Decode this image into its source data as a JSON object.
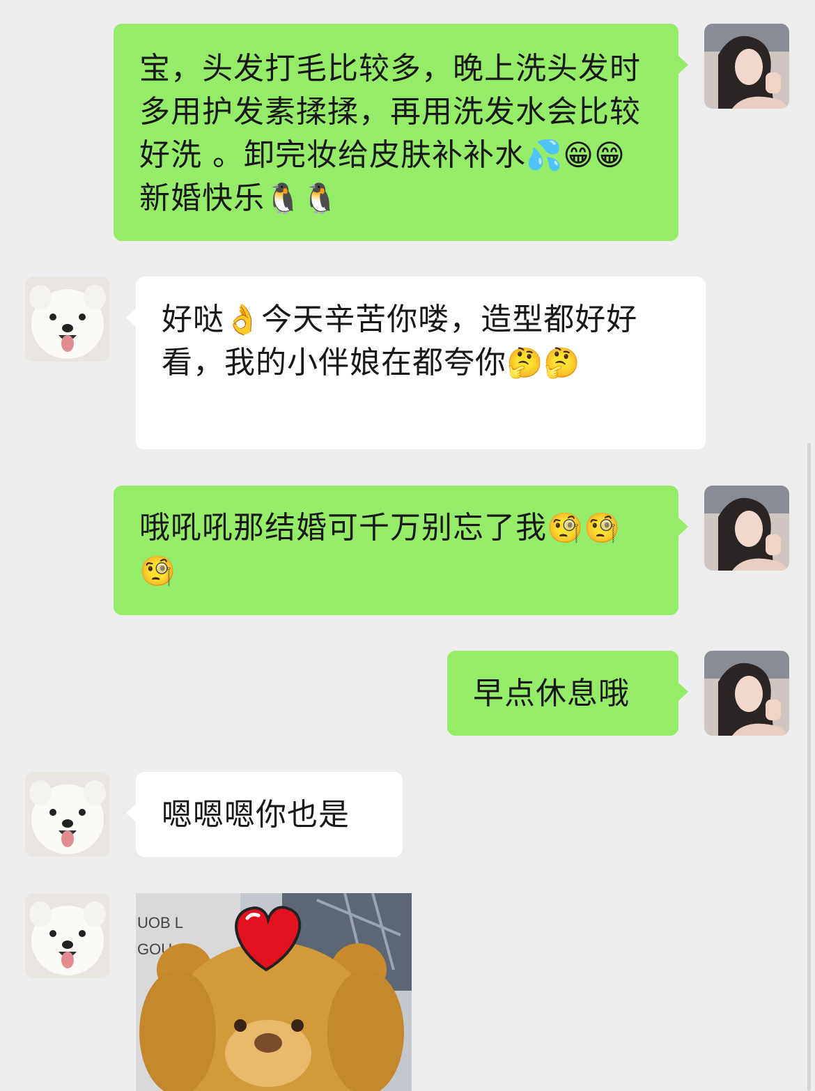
{
  "messages": [
    {
      "sender": "me",
      "parts": [
        {
          "t": "宝，头发打毛比较多，晚上洗头发时多用护发素揉揉，再用洗发水会比较好洗 。卸完妆给皮肤补补水"
        },
        {
          "e": "💦"
        },
        {
          "e": "😁"
        },
        {
          "e": "😁"
        },
        {
          "t": "新婚快乐"
        },
        {
          "e": "🐧"
        },
        {
          "e": "🐧"
        }
      ]
    },
    {
      "sender": "them",
      "parts": [
        {
          "t": "好哒"
        },
        {
          "e": "👌"
        },
        {
          "t": "今天辛苦你喽，造型都好好看，我的小伴娘在都夸你"
        },
        {
          "e": "🤔"
        },
        {
          "e": "🤔"
        }
      ]
    },
    {
      "sender": "me",
      "parts": [
        {
          "t": "哦吼吼那结婚可千万别忘了我"
        },
        {
          "e": "🧐"
        },
        {
          "e": "🧐"
        },
        {
          "e": "🧐"
        }
      ]
    },
    {
      "sender": "me",
      "parts": [
        {
          "t": "早点休息哦"
        }
      ]
    },
    {
      "sender": "them",
      "parts": [
        {
          "t": "嗯嗯嗯你也是"
        }
      ]
    },
    {
      "sender": "them",
      "sticker": {
        "name": "teddy-bear-heart-sticker",
        "visible_text": [
          "UOB L",
          "GOU"
        ]
      }
    }
  ]
}
